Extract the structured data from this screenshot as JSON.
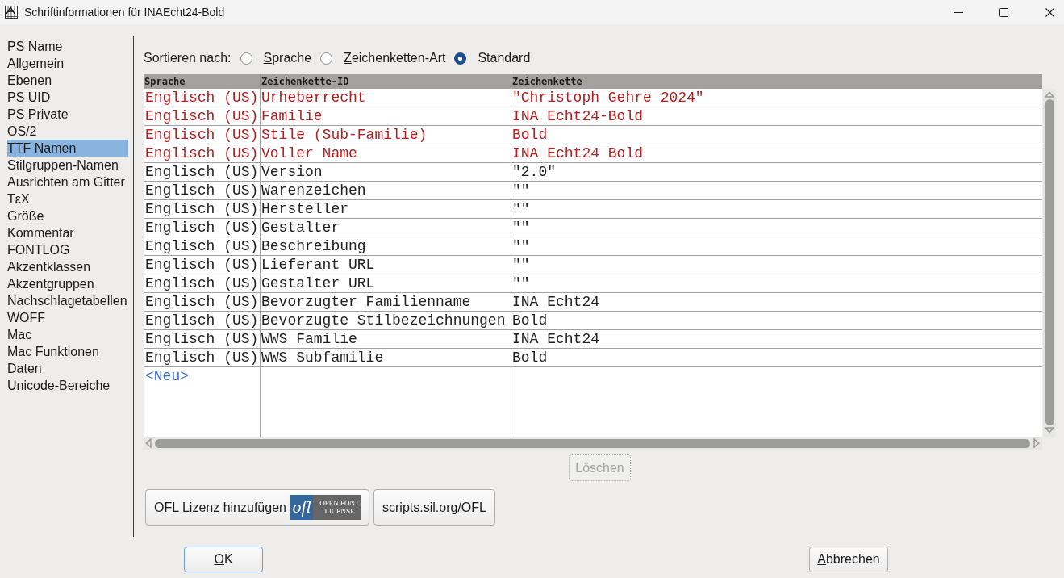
{
  "window": {
    "title": "Schriftinformationen für INAEcht24-Bold"
  },
  "sidebar": {
    "items": [
      {
        "label": "PS Name",
        "selected": false
      },
      {
        "label": "Allgemein",
        "selected": false
      },
      {
        "label": "Ebenen",
        "selected": false
      },
      {
        "label": "PS UID",
        "selected": false
      },
      {
        "label": "PS Private",
        "selected": false
      },
      {
        "label": "OS/2",
        "selected": false
      },
      {
        "label": "TTF Namen",
        "selected": true
      },
      {
        "label": "Stilgruppen-Namen",
        "selected": false
      },
      {
        "label": "Ausrichten am Gitter",
        "selected": false
      },
      {
        "label": "TεX",
        "selected": false
      },
      {
        "label": "Größe",
        "selected": false
      },
      {
        "label": "Kommentar",
        "selected": false
      },
      {
        "label": "FONTLOG",
        "selected": false
      },
      {
        "label": "Akzentklassen",
        "selected": false
      },
      {
        "label": "Akzentgruppen",
        "selected": false
      },
      {
        "label": "Nachschlagetabellen",
        "selected": false
      },
      {
        "label": "WOFF",
        "selected": false
      },
      {
        "label": "Mac",
        "selected": false
      },
      {
        "label": "Mac Funktionen",
        "selected": false
      },
      {
        "label": "Daten",
        "selected": false
      },
      {
        "label": "Unicode-Bereiche",
        "selected": false
      }
    ]
  },
  "sort": {
    "label": "Sortieren nach:",
    "options": [
      {
        "label": "Sprache",
        "selected": false,
        "mnemonic": true
      },
      {
        "label": "Zeichenketten-Art",
        "selected": false,
        "mnemonic": true
      },
      {
        "label": "Standard",
        "selected": true,
        "mnemonic": false
      }
    ]
  },
  "table": {
    "columns": [
      "Sprache",
      "Zeichenkette-ID",
      "Zeichenkette"
    ],
    "rows": [
      {
        "language": "Englisch (US)",
        "string_id": "Urheberrecht",
        "string": "\"Christoph Gehre 2024\"",
        "color": "#b41e1e"
      },
      {
        "language": "Englisch (US)",
        "string_id": "Familie",
        "string": "INA Echt24-Bold",
        "color": "#b41e1e"
      },
      {
        "language": "Englisch (US)",
        "string_id": "Stile (Sub-Familie)",
        "string": "Bold",
        "color": "#b41e1e"
      },
      {
        "language": "Englisch (US)",
        "string_id": "Voller Name",
        "string": "INA Echt24 Bold",
        "color": "#b41e1e"
      },
      {
        "language": "Englisch (US)",
        "string_id": "Version",
        "string": "\"2.0\"",
        "color": "#202020"
      },
      {
        "language": "Englisch (US)",
        "string_id": "Warenzeichen",
        "string": "\"\"",
        "color": "#202020"
      },
      {
        "language": "Englisch (US)",
        "string_id": "Hersteller",
        "string": "\"\"",
        "color": "#202020"
      },
      {
        "language": "Englisch (US)",
        "string_id": "Gestalter",
        "string": "\"\"",
        "color": "#202020"
      },
      {
        "language": "Englisch (US)",
        "string_id": "Beschreibung",
        "string": "\"\"",
        "color": "#202020"
      },
      {
        "language": "Englisch (US)",
        "string_id": "Lieferant URL",
        "string": "\"\"",
        "color": "#202020"
      },
      {
        "language": "Englisch (US)",
        "string_id": "Gestalter URL",
        "string": "\"\"",
        "color": "#202020"
      },
      {
        "language": "Englisch (US)",
        "string_id": "Bevorzugter Familienname",
        "string": "INA Echt24",
        "color": "#202020"
      },
      {
        "language": "Englisch (US)",
        "string_id": "Bevorzugte Stilbezeichnungen",
        "string": "Bold",
        "color": "#202020"
      },
      {
        "language": "Englisch (US)",
        "string_id": "WWS Familie",
        "string": "INA Echt24",
        "color": "#202020"
      },
      {
        "language": "Englisch (US)",
        "string_id": "WWS Subfamilie",
        "string": "Bold",
        "color": "#202020"
      }
    ],
    "new_entry": "<Neu>"
  },
  "delete_button": {
    "label": "Löschen",
    "disabled": true
  },
  "license": {
    "ofl_button": {
      "label": "OFL Lizenz hinzufügen",
      "logo": {
        "mark": "ofl",
        "caption_lines": [
          "OPEN FONT",
          "LICENSE"
        ]
      }
    },
    "link_button": {
      "label": "scripts.sil.org/OFL"
    }
  },
  "dialog_buttons": [
    {
      "label": "OK",
      "mnemonic": true,
      "default": true
    },
    {
      "label": "Abbrechen",
      "mnemonic": true,
      "default": false
    }
  ]
}
